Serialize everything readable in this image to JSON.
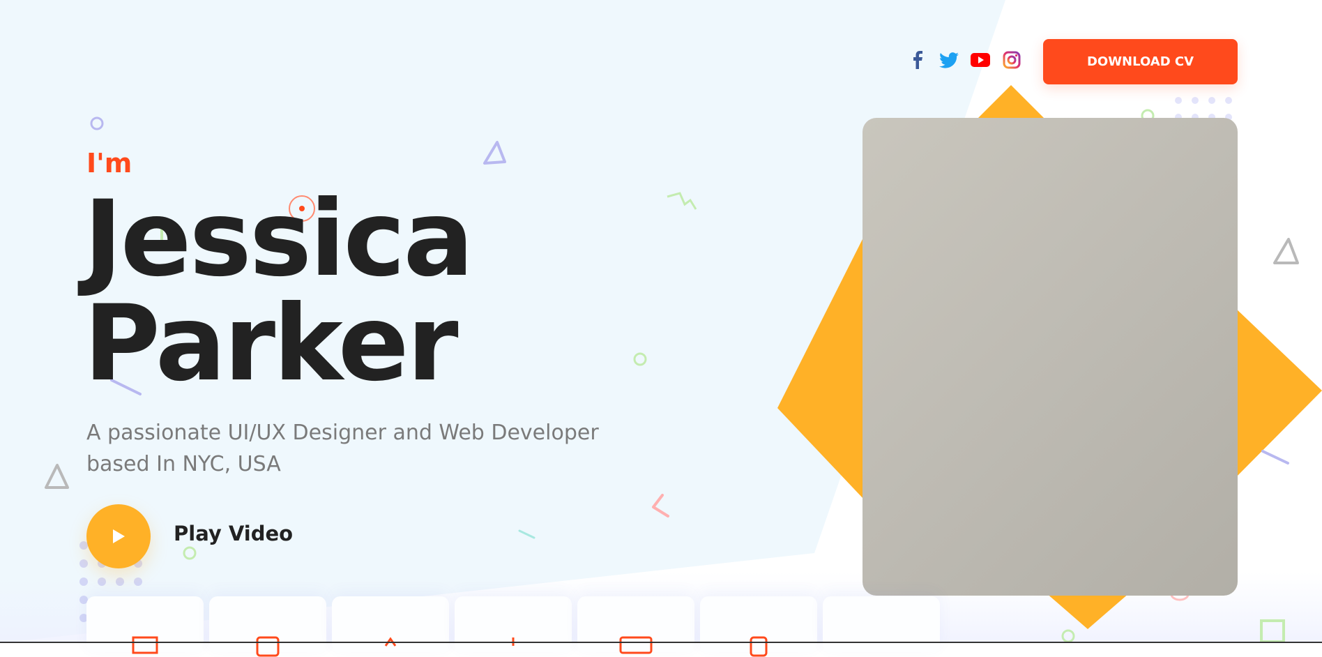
{
  "header": {
    "social": [
      {
        "icon": "facebook-icon",
        "color": "#3b5998"
      },
      {
        "icon": "twitter-icon",
        "color": "#1da1f2"
      },
      {
        "icon": "youtube-icon",
        "color": "#ff0000"
      },
      {
        "icon": "instagram-icon",
        "color": "#e1306c"
      }
    ],
    "cv_button": "DOWNLOAD CV"
  },
  "hero": {
    "greeting": "I'm",
    "first_name": "Jessica",
    "last_name": "Parker",
    "tagline": "A passionate UI/UX Designer and Web Developer based In NYC, USA",
    "play_label": "Play Video"
  },
  "colors": {
    "accent": "#ff4a1c",
    "secondary": "#ffb127",
    "hero_bg": "#eff8fd",
    "text": "#222222",
    "muted": "#7a7a7a"
  },
  "service_cards": [
    {
      "icon": "monitor-icon"
    },
    {
      "icon": "tablet-icon"
    },
    {
      "icon": "pen-icon"
    },
    {
      "icon": "brush-icon"
    },
    {
      "icon": "laptop-icon"
    },
    {
      "icon": "phone-icon"
    },
    {
      "icon": "blank"
    }
  ]
}
